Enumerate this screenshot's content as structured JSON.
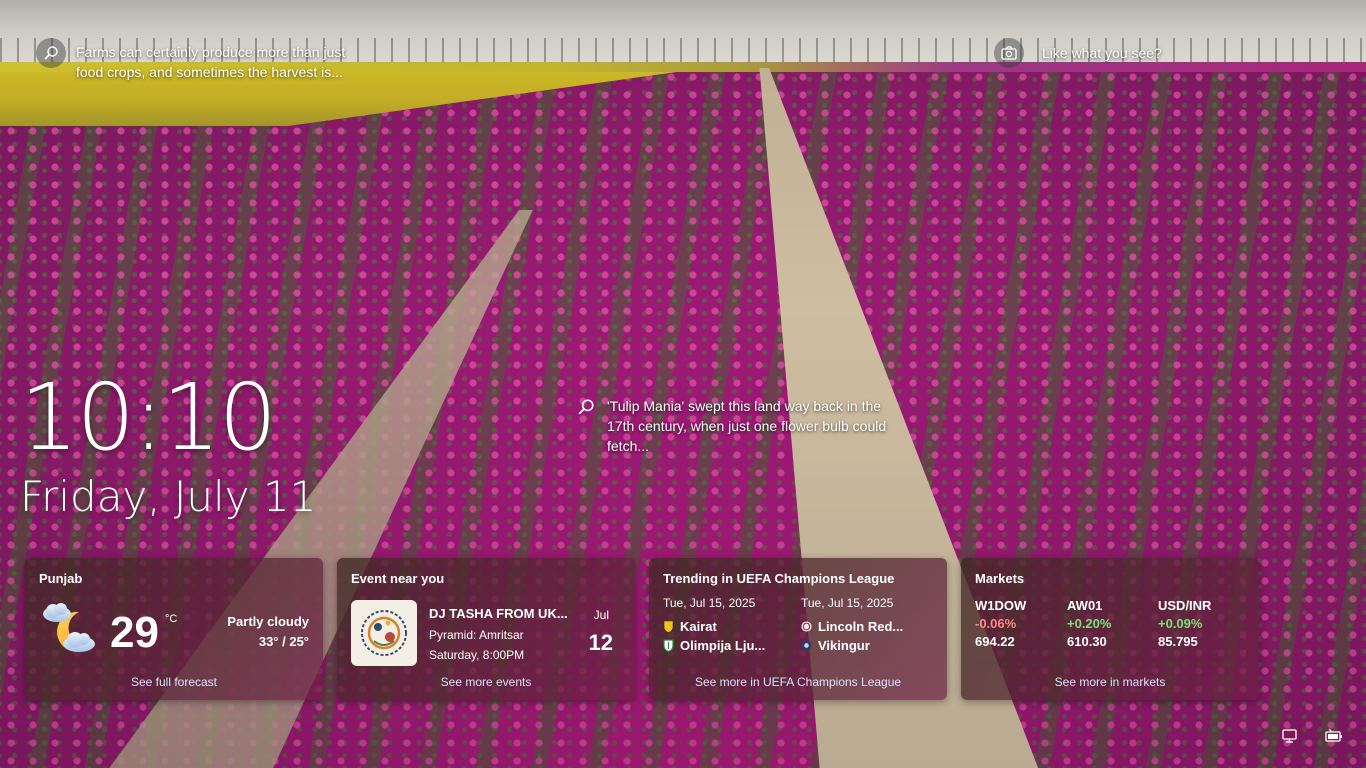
{
  "spotlight": {
    "caption_top": "Farms can certainly produce more than just food crops, and sometimes the harvest is...",
    "like_prompt": "Like what you see?",
    "caption_mid": "'Tulip Mania' swept this land way back in the 17th century, when just one flower bulb could fetch..."
  },
  "clock": {
    "time": "10:10",
    "date": "Friday, July 11"
  },
  "weather": {
    "location": "Punjab",
    "temperature": "29",
    "unit": "°C",
    "condition": "Partly cloudy",
    "range": "33° / 25°",
    "link": "See full forecast",
    "icon": "partly-cloudy-night-icon"
  },
  "event": {
    "title": "Event near you",
    "name": "DJ TASHA FROM UK...",
    "venue": "Pyramid: Amritsar",
    "when": "Saturday, 8:00PM",
    "month": "Jul",
    "day": "12",
    "link": "See more events"
  },
  "sports": {
    "title": "Trending in UEFA Champions League",
    "matches": [
      {
        "date": "Tue, Jul 15, 2025",
        "team1": "Kairat",
        "team2": "Olimpija Lju..."
      },
      {
        "date": "Tue, Jul 15, 2025",
        "team1": "Lincoln Red...",
        "team2": "Vikingur"
      }
    ],
    "link": "See more in UEFA Champions League"
  },
  "markets": {
    "title": "Markets",
    "items": [
      {
        "symbol": "W1DOW",
        "change": "-0.06%",
        "value": "694.22",
        "direction": "down"
      },
      {
        "symbol": "AW01",
        "change": "+0.20%",
        "value": "610.30",
        "direction": "up"
      },
      {
        "symbol": "USD/INR",
        "change": "+0.09%",
        "value": "85.795",
        "direction": "up"
      }
    ],
    "link": "See more in markets"
  },
  "colors": {
    "down": "#ff8a8a",
    "up": "#7fe07a",
    "link": "#d9e6ff"
  },
  "tray": {
    "network_icon": "network-icon",
    "battery_icon": "battery-icon"
  }
}
